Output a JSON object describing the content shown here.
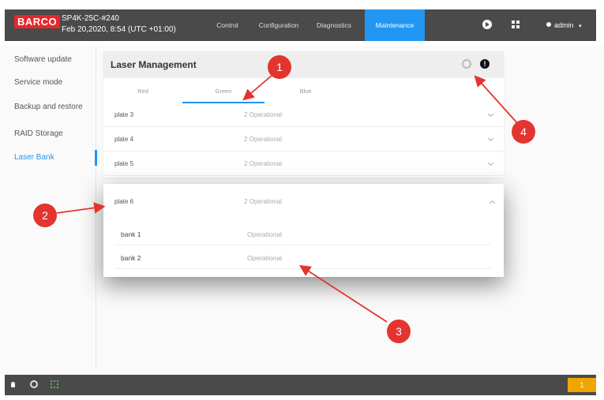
{
  "brand": {
    "logo_text": "BARCO",
    "accent": "#2196f3",
    "brand_red": "#e8262b",
    "callout_red": "#e3342f"
  },
  "device": {
    "name": "SP4K-25C-#240",
    "date": "Feb 20,2020, 8:54 (UTC +01:00)"
  },
  "nav": {
    "items": [
      {
        "label": "Control"
      },
      {
        "label": "Configuration"
      },
      {
        "label": "Diagnostics"
      },
      {
        "label": "Maintenance",
        "active": true
      }
    ],
    "user_label": "admin"
  },
  "sidebar": {
    "items": [
      {
        "label": "Software update"
      },
      {
        "label": "Service mode"
      },
      {
        "label": "Backup and restore"
      },
      {
        "label": "RAID Storage"
      },
      {
        "label": "Laser Bank",
        "active": true
      }
    ]
  },
  "panel": {
    "title": "Laser Management",
    "tabs": [
      {
        "label": "Red"
      },
      {
        "label": "Green",
        "active": true
      },
      {
        "label": "Blue"
      }
    ],
    "plates": [
      {
        "name": "plate 3",
        "status": "2 Operational"
      },
      {
        "name": "plate 4",
        "status": "2 Operational"
      },
      {
        "name": "plate 5",
        "status": "2 Operational"
      }
    ]
  },
  "expanded": {
    "name": "plate 6",
    "status": "2 Operational",
    "banks": [
      {
        "name": "bank 1",
        "status": "Operational"
      },
      {
        "name": "bank 2",
        "status": "Operational"
      }
    ]
  },
  "statusbar": {
    "notification_count": "1"
  },
  "callouts": [
    "1",
    "2",
    "3",
    "4"
  ]
}
